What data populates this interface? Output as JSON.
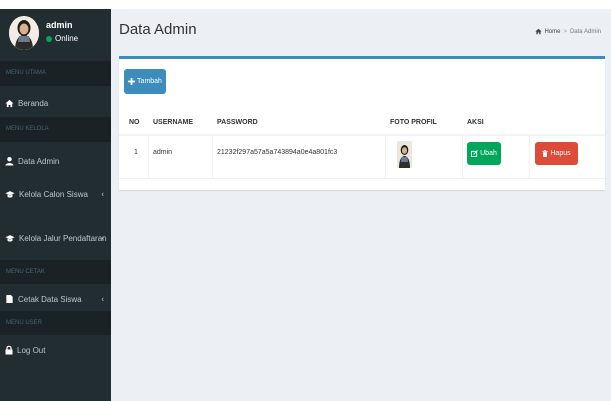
{
  "sidebar": {
    "user": {
      "name": "admin",
      "status": "Online"
    },
    "sections": [
      {
        "header": "MENU UTAMA"
      },
      {
        "header": "MENU KELOLA"
      },
      {
        "header": "MENU CETAK"
      },
      {
        "header": "MENU USER"
      }
    ],
    "items": [
      {
        "label": "Beranda",
        "icon": "home-icon"
      },
      {
        "label": "Data Admin",
        "icon": "user-icon"
      },
      {
        "label": "Kelola Calon Siswa",
        "icon": "graduation-cap-icon"
      },
      {
        "label": "Kelola Jalur Pendaftaran",
        "icon": "graduation-cap-icon"
      },
      {
        "label": "Cetak Data Siswa",
        "icon": "file-icon"
      },
      {
        "label": "Log Out",
        "icon": "lock-icon"
      }
    ]
  },
  "header": {
    "title": "Data Admin",
    "breadcrumb": {
      "home": "Home",
      "current": "Data Admin"
    }
  },
  "main": {
    "add_button": "Tambah",
    "table": {
      "columns": [
        "NO",
        "USERNAME",
        "PASSWORD",
        "FOTO PROFIL",
        "AKSI"
      ],
      "rows": [
        {
          "no": "1",
          "username": "admin",
          "password": "21232f297a57a5a743894a0e4a801fc3",
          "edit_label": "Ubah",
          "delete_label": "Hapus"
        }
      ]
    }
  },
  "colors": {
    "sidebar_bg": "#222d32",
    "primary": "#3c8dbc",
    "success": "#00a65a",
    "danger": "#dd4b39",
    "online": "#00a65a"
  }
}
